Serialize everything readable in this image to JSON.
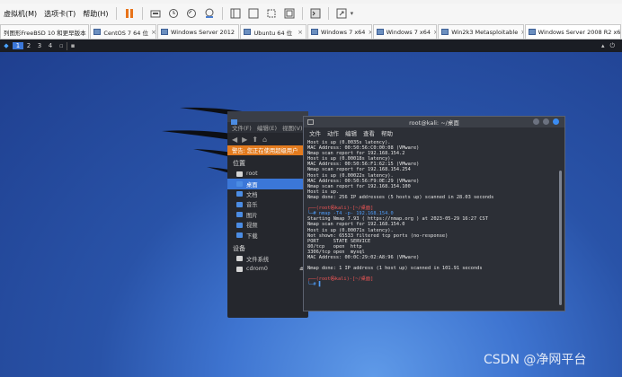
{
  "menubar": {
    "items": [
      "虚拟机(M)",
      "选项卡(T)",
      "帮助(H)"
    ],
    "toolbar_icons": [
      "pause-icon",
      "send-keys-icon",
      "snapshot-icon",
      "revert-icon",
      "manage-snapshots-icon",
      "single-window-icon",
      "multi-window-icon",
      "fit-icon",
      "fullscreen-icon",
      "console-view-icon",
      "stretch-icon"
    ]
  },
  "tabs": [
    {
      "label": "列图形FreeBSD 10 和更早版本"
    },
    {
      "label": "CentOS 7 64 位"
    },
    {
      "label": "Windows Server 2012"
    },
    {
      "label": "Ubuntu 64 位"
    },
    {
      "label": "Windows 7 x64"
    },
    {
      "label": "Windows 7 x64"
    },
    {
      "label": "Win2k3 Metasploitable"
    },
    {
      "label": "Windows Server 2008 R2 x64"
    }
  ],
  "panel": {
    "workspaces": [
      "1",
      "2",
      "3",
      "4"
    ]
  },
  "file_manager": {
    "menu": [
      "文件(F)",
      "编辑(E)",
      "视图(V)"
    ],
    "warning": "警告: 您正在使用超级用户",
    "places_header": "位置",
    "places": [
      {
        "label": "root",
        "icon": "folder-icon"
      },
      {
        "label": "桌面",
        "icon": "desktop-folder-icon"
      },
      {
        "label": "文档",
        "icon": "documents-folder-icon"
      },
      {
        "label": "音乐",
        "icon": "music-folder-icon"
      },
      {
        "label": "图片",
        "icon": "pictures-folder-icon"
      },
      {
        "label": "视频",
        "icon": "videos-folder-icon"
      },
      {
        "label": "下载",
        "icon": "downloads-folder-icon"
      }
    ],
    "devices_header": "设备",
    "devices": [
      {
        "label": "文件系统",
        "icon": "drive-icon"
      },
      {
        "label": "cdrom0",
        "icon": "cdrom-icon",
        "eject": "⏏"
      }
    ]
  },
  "terminal": {
    "title": "root@kali: ~/桌面",
    "menu": [
      "文件",
      "动作",
      "编辑",
      "查看",
      "帮助"
    ],
    "lines": [
      {
        "text": "Host is up (0.0035s latency).",
        "color": "white"
      },
      {
        "text": "MAC Address: 00:50:56:C0:00:08 (VMware)",
        "color": "white"
      },
      {
        "text": "Nmap scan report for 192.168.154.2",
        "color": "white"
      },
      {
        "text": "Host is up (0.00018s latency).",
        "color": "white"
      },
      {
        "text": "MAC Address: 00:50:56:F1:62:15 (VMware)",
        "color": "white"
      },
      {
        "text": "Nmap scan report for 192.168.154.254",
        "color": "white"
      },
      {
        "text": "Host is up (0.00022s latency).",
        "color": "white"
      },
      {
        "text": "MAC Address: 00:50:56:F9:0E:29 (VMware)",
        "color": "white"
      },
      {
        "text": "Nmap scan report for 192.168.154.100",
        "color": "white"
      },
      {
        "text": "Host is up.",
        "color": "white"
      },
      {
        "text": "Nmap done: 256 IP addresses (5 hosts up) scanned in 28.03 seconds",
        "color": "white"
      },
      {
        "text": "",
        "color": "white"
      },
      {
        "text": "┌──(root㉿kali)-[~/桌面]",
        "color": "red"
      },
      {
        "text": "└─# nmap -T4 -p- 192.168.154.0",
        "color": "blue"
      },
      {
        "text": "Starting Nmap 7.93 ( https://nmap.org ) at 2023-05-29 16:27 CST",
        "color": "white"
      },
      {
        "text": "Nmap scan report for 192.168.154.0",
        "color": "white"
      },
      {
        "text": "Host is up (0.00071s latency).",
        "color": "white"
      },
      {
        "text": "Not shown: 65533 filtered tcp ports (no-response)",
        "color": "white"
      },
      {
        "text": "PORT     STATE SERVICE",
        "color": "white"
      },
      {
        "text": "80/tcp   open  http",
        "color": "white"
      },
      {
        "text": "3306/tcp open  mysql",
        "color": "white"
      },
      {
        "text": "MAC Address: 00:0C:29:02:A8:96 (VMware)",
        "color": "white"
      },
      {
        "text": "",
        "color": "white"
      },
      {
        "text": "Nmap done: 1 IP address (1 host up) scanned in 101.91 seconds",
        "color": "white"
      },
      {
        "text": "",
        "color": "white"
      },
      {
        "text": "┌──(root㉿kali)-[~/桌面]",
        "color": "red"
      },
      {
        "text": "└─# ▌",
        "color": "blue"
      }
    ]
  },
  "watermark": "CSDN @净网平台",
  "colors": {
    "accent": "#3b77d8",
    "warning": "#e37b1e",
    "prompt_red": "#ef5555",
    "prompt_blue": "#4f9cf7"
  }
}
